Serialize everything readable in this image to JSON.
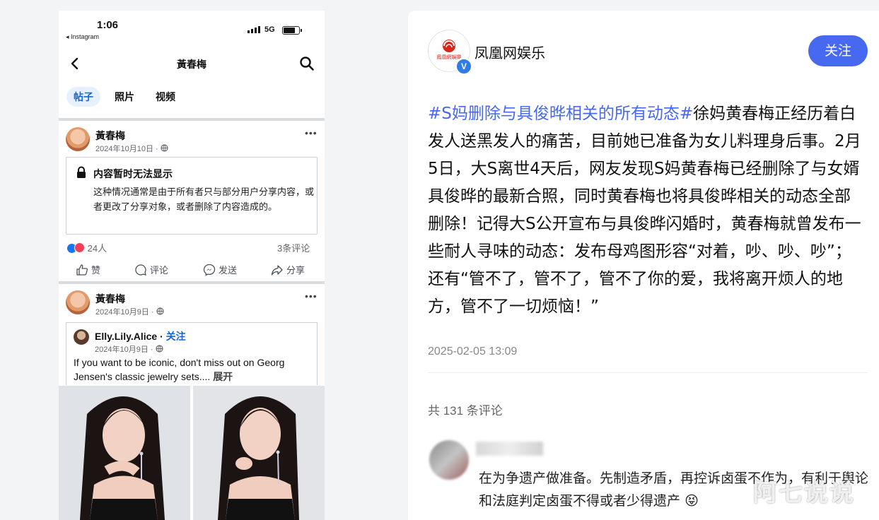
{
  "phone": {
    "status_time": "1:06",
    "status_back_app": "◂ Instagram",
    "network": "5G",
    "page_title": "黃春梅",
    "tabs": [
      "帖子",
      "照片",
      "视频"
    ],
    "post1": {
      "author": "黃春梅",
      "date": "2024年10月10日 ·",
      "notice_title": "内容暂时无法显示",
      "notice_body": "这种情况通常是由于所有者只与部分用户分享内容，或者更改了分享对象，或者删除了内容造成的。",
      "reactions": "24人",
      "comments": "3条评论",
      "actions": [
        "赞",
        "评论",
        "发送",
        "分享"
      ]
    },
    "post2": {
      "author": "黃春梅",
      "date": "2024年10月9日 ·",
      "shared_author": "Elly.Lily.Alice",
      "shared_follow": "关注",
      "shared_date": "2024年10月9日 ·",
      "shared_text": "If you want to be iconic, don't miss out on Georg Jensen's classic jewelry sets....",
      "expand": "展开"
    }
  },
  "article": {
    "author": "凤凰网娱乐",
    "logo_caption": "鳳凰網娛樂",
    "follow_label": "关注",
    "hashtag": "#S妈删除与具俊晔相关的所有动态#",
    "body": "徐妈黄春梅正经历着白发人送黑发人的痛苦，目前她已准备为女儿料理身后事。2月5日，大S离世4天后，网友发现S妈黄春梅已经删除了与女婿具俊晔的最新合照，同时黄春梅也将具俊晔相关的动态全部删除！记得大S公开宣布与具俊晔闪婚时，黄春梅就曾发布一些耐人寻味的动态：发布母鸡图形容“对着，吵、吵、吵”；还有“管不了，管不了，管不了你的爱，我将离开烦人的地方，管不了一切烦恼！”",
    "publish_time": "2025-02-05 13:09",
    "comment_count": "共 131 条评论",
    "comment_text": "在为争遗产做准备。先制造矛盾，再控诉卤蛋不作为，有利于舆论和法庭判定卤蛋不得或者少得遗产",
    "comment_emoji": "😝",
    "watermark": "阿七说说"
  },
  "colors": {
    "accent": "#4669f0",
    "fb_blue": "#1766d1"
  }
}
